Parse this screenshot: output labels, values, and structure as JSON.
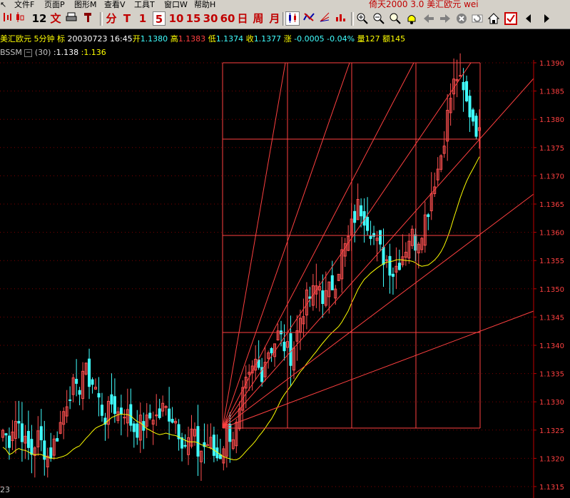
{
  "menu": {
    "file": "文件F",
    "page": "页面P",
    "graph": "图形M",
    "view": "查看V",
    "tools": "工具T",
    "window": "窗口W",
    "help": "帮助H",
    "app_title": "倚天2000 3.0 美汇欧元 wei"
  },
  "toolbar": {
    "period_12": "12",
    "text_btn": "文",
    "min_btn": "分",
    "tick_btn": "T",
    "p1": "1",
    "p5": "5",
    "p10": "10",
    "p15": "15",
    "p30": "30",
    "p60": "60",
    "day": "日",
    "week": "周",
    "month": "月"
  },
  "quote": {
    "symbol": "美汇欧元",
    "period": "5分钟",
    "mark": "标",
    "datetime": "20030723 16:45",
    "open_label": "开",
    "open": "1.1380",
    "high_label": "高",
    "high": "1.1383",
    "low_label": "低",
    "low": "1.1374",
    "close_label": "收",
    "close": "1.1377",
    "chg_label": "涨",
    "chg": "-0.0005",
    "chg_pct": "-0.04%",
    "vol_label": "量",
    "vol": "127",
    "amt_label": "额",
    "amt": "145"
  },
  "indicator": {
    "name": "BSSM",
    "param": "(30)",
    "v1": ":1.138",
    "v2": ":1.136"
  },
  "bottom_label": "23",
  "colors": {
    "bg": "#000000",
    "up": "#ff5050",
    "down": "#40ffff",
    "ma": "#ffff00",
    "gann": "#ff4040",
    "axis": "#c00000",
    "label": "#ff4040"
  },
  "chart_data": {
    "type": "candlestick",
    "y_ticks": [
      "1.1390",
      "1.1385",
      "1.1380",
      "1.1375",
      "1.1370",
      "1.1365",
      "1.1360",
      "1.1355",
      "1.1350",
      "1.1345",
      "1.1340",
      "1.1335",
      "1.1330",
      "1.1325",
      "1.1320",
      "1.1315"
    ],
    "ylim": [
      1.1315,
      1.139
    ],
    "grid": "dashed horizontal",
    "close_path": [
      1.1325,
      1.1323,
      1.1327,
      1.1326,
      1.1322,
      1.1321,
      1.1324,
      1.1322,
      1.132,
      1.1323,
      1.1326,
      1.133,
      1.1333,
      1.1331,
      1.1336,
      1.1334,
      1.1333,
      1.1329,
      1.1327,
      1.133,
      1.1328,
      1.1329,
      1.1327,
      1.1325,
      1.1326,
      1.1326,
      1.1328,
      1.1327,
      1.1329,
      1.1328,
      1.1327,
      1.1324,
      1.1322,
      1.1325,
      1.1321,
      1.1322,
      1.1323,
      1.132,
      1.1321,
      1.1325,
      1.1324,
      1.1326,
      1.1332,
      1.1334,
      1.1337,
      1.1335,
      1.1339,
      1.134,
      1.1342,
      1.134,
      1.1338,
      1.1341,
      1.1346,
      1.1348,
      1.1349,
      1.1351,
      1.1348,
      1.135,
      1.1352,
      1.1356,
      1.1358,
      1.1362,
      1.1365,
      1.1363,
      1.1361,
      1.1358,
      1.1356,
      1.1355,
      1.1353,
      1.1355,
      1.1357,
      1.136,
      1.1358,
      1.1361,
      1.1364,
      1.1369,
      1.1372,
      1.1378,
      1.1384,
      1.1388,
      1.1385,
      1.1382,
      1.138,
      1.1377
    ]
  }
}
